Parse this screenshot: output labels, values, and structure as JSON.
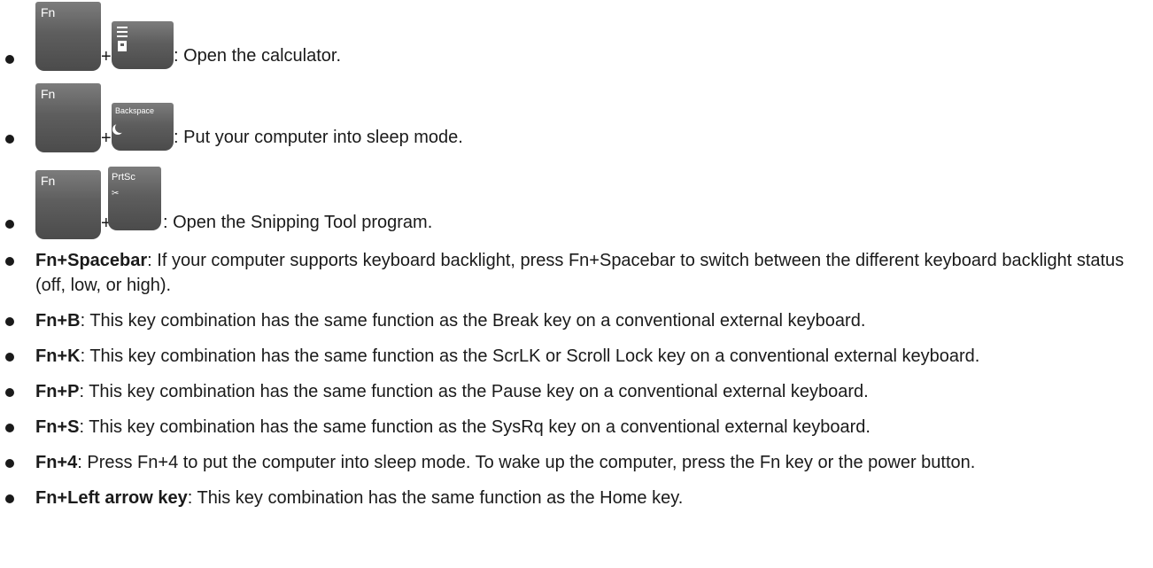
{
  "shortcuts": [
    {
      "fn_key_label": "Fn",
      "plus": "+",
      "second_key_label": "",
      "second_key_icon": "calculator-icon",
      "description": ": Open the calculator."
    },
    {
      "fn_key_label": "Fn",
      "plus": "+",
      "second_key_label": "Backspace",
      "second_key_icon": "moon-sleep-icon",
      "description": ": Put your computer into sleep mode."
    },
    {
      "fn_key_label": "Fn",
      "plus": "+",
      "second_key_label": "PrtSc",
      "second_key_icon": "snipping-tool-icon",
      "description": ": Open the Snipping Tool program."
    }
  ],
  "items": [
    {
      "term": "Fn+Spacebar",
      "text": ": If your computer supports keyboard backlight, press Fn+Spacebar to switch between the different keyboard backlight status (off, low, or high)."
    },
    {
      "term": "Fn+B",
      "text": ": This key combination has the same function as the Break key on a conventional external keyboard."
    },
    {
      "term": "Fn+K",
      "text": ": This key combination has the same function as the ScrLK or Scroll Lock key on a conventional external keyboard."
    },
    {
      "term": "Fn+P",
      "text": ": This key combination has the same function as the Pause key on a conventional external keyboard."
    },
    {
      "term": "Fn+S",
      "text": ": This key combination has the same function as the SysRq key on a conventional external keyboard."
    },
    {
      "term": "Fn+4",
      "text": ": Press Fn+4 to put the computer into sleep mode. To wake up the computer, press the Fn key or the power button."
    },
    {
      "term": "Fn+Left arrow key",
      "text": ": This key combination has the same function as the Home key."
    }
  ]
}
